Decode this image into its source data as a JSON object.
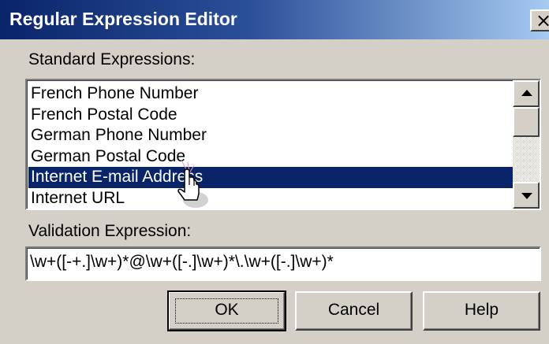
{
  "window": {
    "title": "Regular Expression Editor",
    "close_glyph": "×"
  },
  "standard_expressions": {
    "label": "Standard Expressions:",
    "items": [
      "French Phone Number",
      "French Postal Code",
      "German Phone Number",
      "German Postal Code",
      "Internet E-mail Address",
      "Internet URL"
    ],
    "selected": "Internet E-mail Address"
  },
  "validation": {
    "label": "Validation Expression:",
    "value": "\\w+([-+.]\\w+)*@\\w+([-.]\\w+)*\\.\\w+([-.]\\w+)*"
  },
  "buttons": {
    "ok": "OK",
    "cancel": "Cancel",
    "help": "Help"
  },
  "colors": {
    "dialog_bg": "#d4d0c8",
    "title_start": "#0a246a",
    "title_end": "#a6caf0",
    "selection": "#0a246a"
  },
  "icons": {
    "cursor": "hand-pointer-icon",
    "scroll_up": "arrow-up-icon",
    "scroll_down": "arrow-down-icon"
  }
}
